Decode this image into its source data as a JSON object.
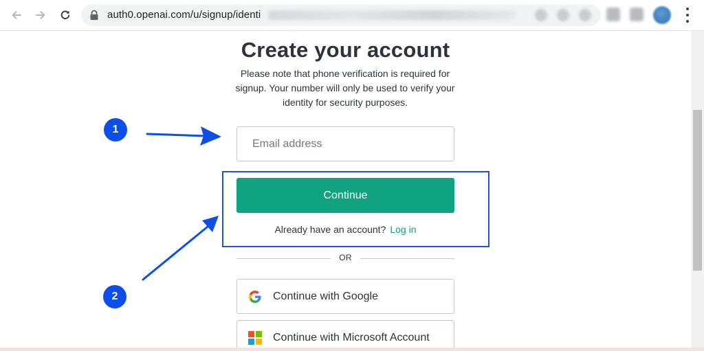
{
  "browser": {
    "url_text": "auth0.openai.com/u/signup/identi",
    "icons": {
      "back": "arrow-left-icon",
      "forward": "arrow-right-icon",
      "reload": "reload-icon",
      "lock": "lock-icon",
      "menu": "more-vertical-icon"
    }
  },
  "signup": {
    "title": "Create your account",
    "note": "Please note that phone verification is required for signup. Your number will only be used to verify your identity for security purposes.",
    "email_placeholder": "Email address",
    "continue_label": "Continue",
    "login_prompt": "Already have an account?",
    "login_link": "Log in",
    "divider_text": "OR",
    "google_label": "Continue with Google",
    "microsoft_label": "Continue with Microsoft Account"
  },
  "annotations": {
    "step_1": "1",
    "step_2": "2"
  },
  "colors": {
    "accent_green": "#10a37f",
    "annotation_blue": "#0b4ee8",
    "highlight_border": "#1f56c7",
    "text_dark": "#2d333a"
  }
}
